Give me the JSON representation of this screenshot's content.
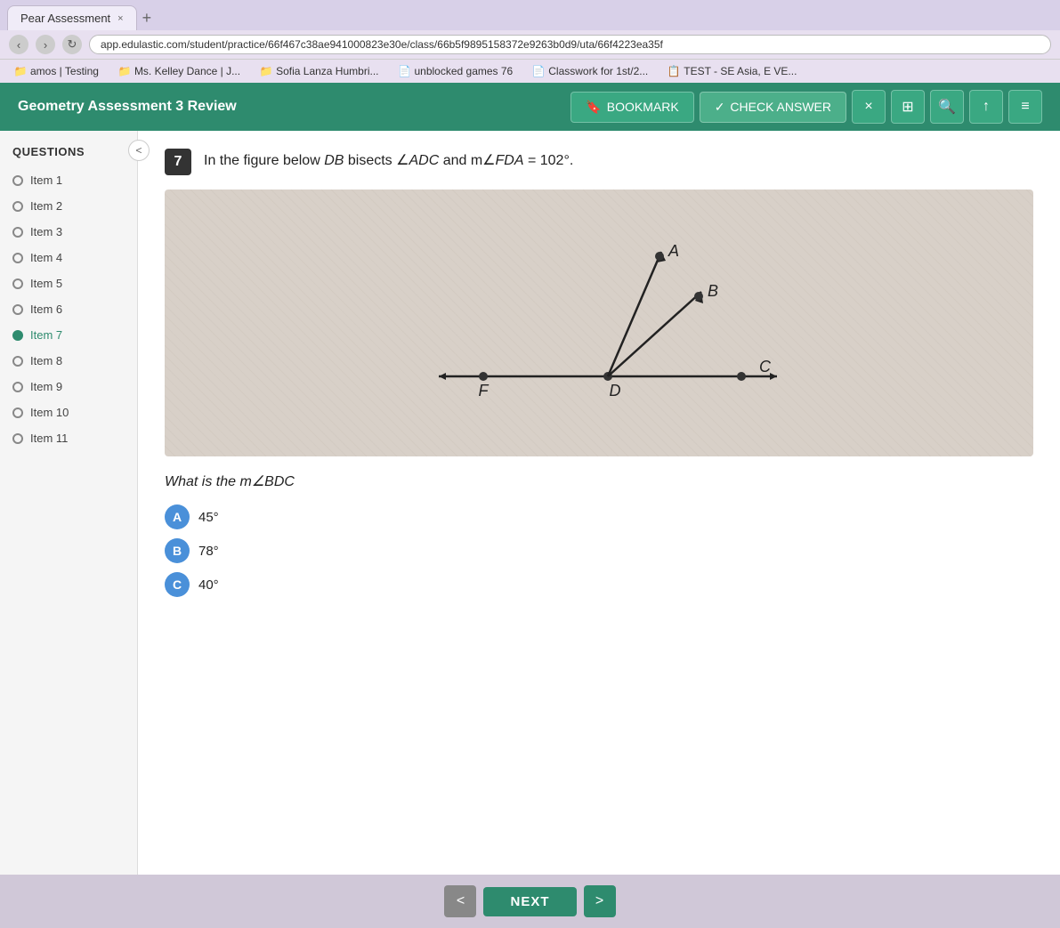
{
  "browser": {
    "tab_title": "Pear Assessment",
    "tab_close": "×",
    "tab_new": "+",
    "address": "app.edulastic.com/student/practice/66f467c38ae941000823e30e/class/66b5f9895158372e9263b0d9/uta/66f4223ea35f",
    "bookmarks": [
      {
        "label": "amos | Testing",
        "icon": "folder"
      },
      {
        "label": "Ms. Kelley Dance | J...",
        "icon": "folder"
      },
      {
        "label": "Sofia Lanza Humbri...",
        "icon": "folder"
      },
      {
        "label": "unblocked games 76",
        "icon": "page"
      },
      {
        "label": "Classwork for 1st/2...",
        "icon": "page"
      },
      {
        "label": "TEST - SE Asia, E VE...",
        "icon": "doc"
      }
    ]
  },
  "header": {
    "title": "Geometry Assessment 3 Review",
    "bookmark_label": "BOOKMARK",
    "check_answer_label": "CHECK ANSWER",
    "close_icon": "×",
    "calc_icon": "⊞",
    "search_icon": "🔍",
    "share_icon": "↑",
    "menu_icon": "≡"
  },
  "sidebar": {
    "title": "QUESTIONS",
    "collapse_icon": "<",
    "items": [
      {
        "label": "Item 1",
        "active": false
      },
      {
        "label": "Item 2",
        "active": false
      },
      {
        "label": "Item 3",
        "active": false
      },
      {
        "label": "Item 4",
        "active": false
      },
      {
        "label": "Item 5",
        "active": false
      },
      {
        "label": "Item 6",
        "active": false
      },
      {
        "label": "Item 7",
        "active": true
      },
      {
        "label": "Item 8",
        "active": false
      },
      {
        "label": "Item 9",
        "active": false
      },
      {
        "label": "Item 10",
        "active": false
      },
      {
        "label": "Item 11",
        "active": false
      }
    ]
  },
  "question": {
    "number": "7",
    "text": "In the figure below DB bisects ∠ADC and m∠FDA = 102°.",
    "body_text": "What is the m∠BDC",
    "choices": [
      {
        "id": "A",
        "text": "45°"
      },
      {
        "id": "B",
        "text": "78°"
      },
      {
        "id": "C",
        "text": "40°"
      }
    ]
  },
  "footer": {
    "prev_label": "<",
    "next_label": "NEXT",
    "next_arrow": ">"
  }
}
